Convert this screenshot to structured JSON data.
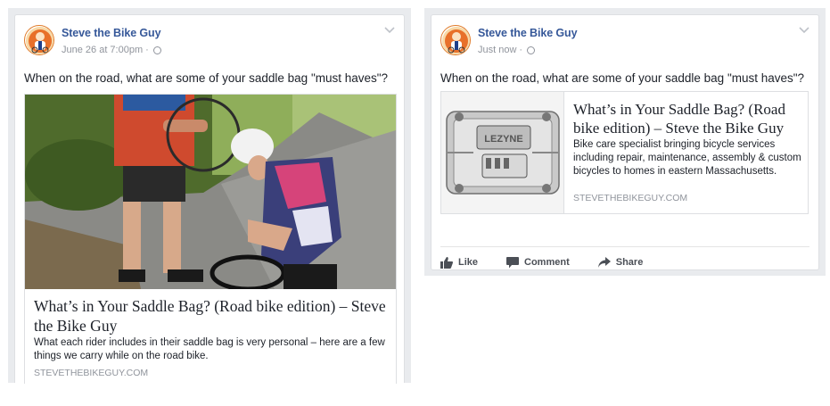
{
  "posts": [
    {
      "author": "Steve the Bike Guy",
      "timestamp": "June 26 at 7:00pm",
      "text": "When on the road, what are some of your saddle bag \"must haves\"?",
      "link": {
        "title": "What’s in Your Saddle Bag? (Road bike edition) – Steve the Bike Guy",
        "description": "What each rider includes in their saddle bag is very personal – here are a few things we carry while on the road bike.",
        "domain": "STEVETHEBIKEGUY.COM"
      }
    },
    {
      "author": "Steve the Bike Guy",
      "timestamp": "Just now",
      "text": "When on the road, what are some of your saddle bag \"must haves\"?",
      "link": {
        "title": "What’s in Your Saddle Bag? (Road bike edition) – Steve the Bike Guy",
        "description": "Bike care specialist bringing bicycle services including repair, maintenance, assembly & custom bicycles to homes in eastern Massachusetts.",
        "domain": "STEVETHEBIKEGUY.COM"
      },
      "actions": {
        "like": "Like",
        "comment": "Comment",
        "share": "Share"
      }
    }
  ],
  "colors": {
    "author": "#365899",
    "muted": "#90949c",
    "panel": "#e9ebee"
  },
  "icons": [
    "avatar-logo",
    "globe-icon",
    "chevron-down-icon",
    "like-icon",
    "comment-icon",
    "share-icon"
  ]
}
